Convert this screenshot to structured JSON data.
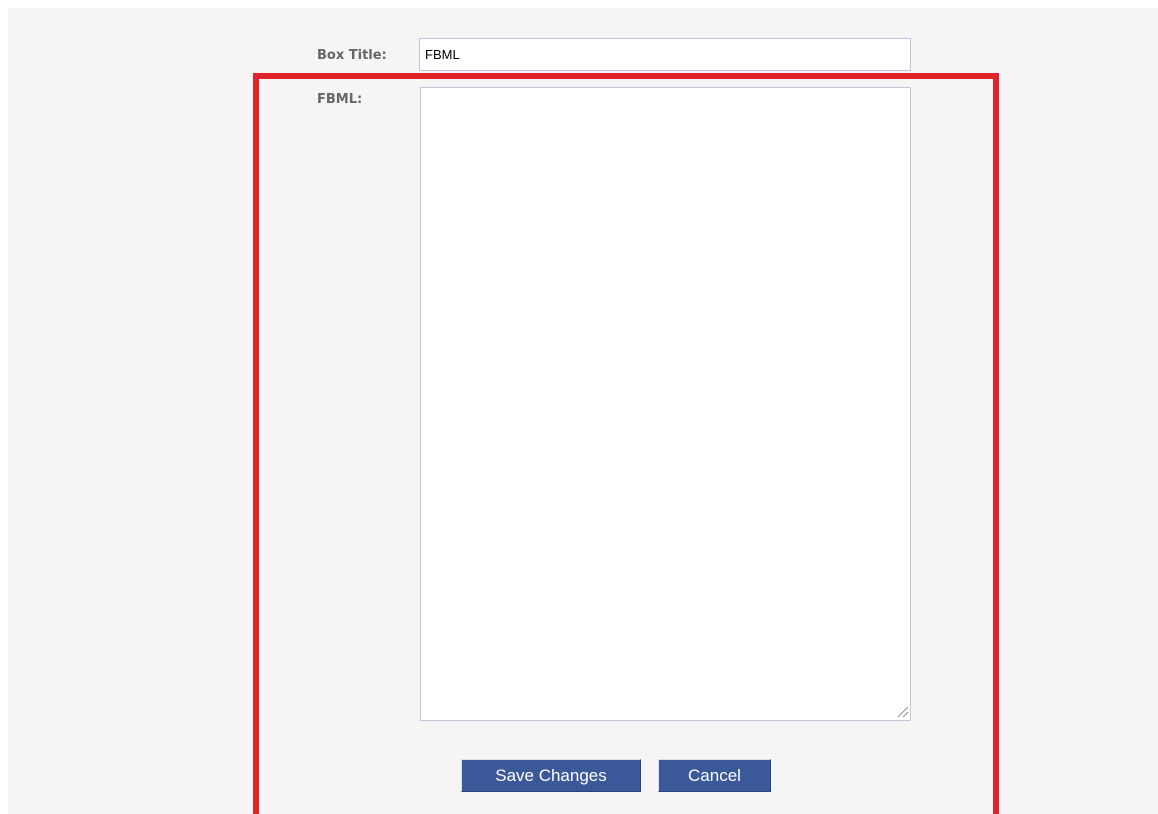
{
  "form": {
    "box_title_label": "Box Title:",
    "box_title_value": "FBML",
    "fbml_label": "FBML:",
    "fbml_value": ""
  },
  "buttons": {
    "save_label": "Save Changes",
    "cancel_label": "Cancel"
  },
  "colors": {
    "highlight": "#e3212b",
    "button": "#3b5998",
    "label": "#666666",
    "panel_bg": "#f5f5f5"
  },
  "icons": {
    "resize": "resize-grip-icon"
  }
}
